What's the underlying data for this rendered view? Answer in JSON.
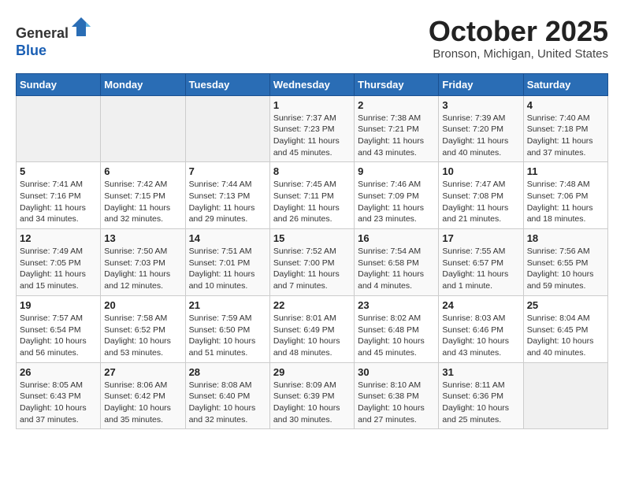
{
  "header": {
    "logo_line1": "General",
    "logo_line2": "Blue",
    "month_title": "October 2025",
    "location": "Bronson, Michigan, United States"
  },
  "weekdays": [
    "Sunday",
    "Monday",
    "Tuesday",
    "Wednesday",
    "Thursday",
    "Friday",
    "Saturday"
  ],
  "weeks": [
    [
      {
        "day": "",
        "info": ""
      },
      {
        "day": "",
        "info": ""
      },
      {
        "day": "",
        "info": ""
      },
      {
        "day": "1",
        "info": "Sunrise: 7:37 AM\nSunset: 7:23 PM\nDaylight: 11 hours\nand 45 minutes."
      },
      {
        "day": "2",
        "info": "Sunrise: 7:38 AM\nSunset: 7:21 PM\nDaylight: 11 hours\nand 43 minutes."
      },
      {
        "day": "3",
        "info": "Sunrise: 7:39 AM\nSunset: 7:20 PM\nDaylight: 11 hours\nand 40 minutes."
      },
      {
        "day": "4",
        "info": "Sunrise: 7:40 AM\nSunset: 7:18 PM\nDaylight: 11 hours\nand 37 minutes."
      }
    ],
    [
      {
        "day": "5",
        "info": "Sunrise: 7:41 AM\nSunset: 7:16 PM\nDaylight: 11 hours\nand 34 minutes."
      },
      {
        "day": "6",
        "info": "Sunrise: 7:42 AM\nSunset: 7:15 PM\nDaylight: 11 hours\nand 32 minutes."
      },
      {
        "day": "7",
        "info": "Sunrise: 7:44 AM\nSunset: 7:13 PM\nDaylight: 11 hours\nand 29 minutes."
      },
      {
        "day": "8",
        "info": "Sunrise: 7:45 AM\nSunset: 7:11 PM\nDaylight: 11 hours\nand 26 minutes."
      },
      {
        "day": "9",
        "info": "Sunrise: 7:46 AM\nSunset: 7:09 PM\nDaylight: 11 hours\nand 23 minutes."
      },
      {
        "day": "10",
        "info": "Sunrise: 7:47 AM\nSunset: 7:08 PM\nDaylight: 11 hours\nand 21 minutes."
      },
      {
        "day": "11",
        "info": "Sunrise: 7:48 AM\nSunset: 7:06 PM\nDaylight: 11 hours\nand 18 minutes."
      }
    ],
    [
      {
        "day": "12",
        "info": "Sunrise: 7:49 AM\nSunset: 7:05 PM\nDaylight: 11 hours\nand 15 minutes."
      },
      {
        "day": "13",
        "info": "Sunrise: 7:50 AM\nSunset: 7:03 PM\nDaylight: 11 hours\nand 12 minutes."
      },
      {
        "day": "14",
        "info": "Sunrise: 7:51 AM\nSunset: 7:01 PM\nDaylight: 11 hours\nand 10 minutes."
      },
      {
        "day": "15",
        "info": "Sunrise: 7:52 AM\nSunset: 7:00 PM\nDaylight: 11 hours\nand 7 minutes."
      },
      {
        "day": "16",
        "info": "Sunrise: 7:54 AM\nSunset: 6:58 PM\nDaylight: 11 hours\nand 4 minutes."
      },
      {
        "day": "17",
        "info": "Sunrise: 7:55 AM\nSunset: 6:57 PM\nDaylight: 11 hours\nand 1 minute."
      },
      {
        "day": "18",
        "info": "Sunrise: 7:56 AM\nSunset: 6:55 PM\nDaylight: 10 hours\nand 59 minutes."
      }
    ],
    [
      {
        "day": "19",
        "info": "Sunrise: 7:57 AM\nSunset: 6:54 PM\nDaylight: 10 hours\nand 56 minutes."
      },
      {
        "day": "20",
        "info": "Sunrise: 7:58 AM\nSunset: 6:52 PM\nDaylight: 10 hours\nand 53 minutes."
      },
      {
        "day": "21",
        "info": "Sunrise: 7:59 AM\nSunset: 6:50 PM\nDaylight: 10 hours\nand 51 minutes."
      },
      {
        "day": "22",
        "info": "Sunrise: 8:01 AM\nSunset: 6:49 PM\nDaylight: 10 hours\nand 48 minutes."
      },
      {
        "day": "23",
        "info": "Sunrise: 8:02 AM\nSunset: 6:48 PM\nDaylight: 10 hours\nand 45 minutes."
      },
      {
        "day": "24",
        "info": "Sunrise: 8:03 AM\nSunset: 6:46 PM\nDaylight: 10 hours\nand 43 minutes."
      },
      {
        "day": "25",
        "info": "Sunrise: 8:04 AM\nSunset: 6:45 PM\nDaylight: 10 hours\nand 40 minutes."
      }
    ],
    [
      {
        "day": "26",
        "info": "Sunrise: 8:05 AM\nSunset: 6:43 PM\nDaylight: 10 hours\nand 37 minutes."
      },
      {
        "day": "27",
        "info": "Sunrise: 8:06 AM\nSunset: 6:42 PM\nDaylight: 10 hours\nand 35 minutes."
      },
      {
        "day": "28",
        "info": "Sunrise: 8:08 AM\nSunset: 6:40 PM\nDaylight: 10 hours\nand 32 minutes."
      },
      {
        "day": "29",
        "info": "Sunrise: 8:09 AM\nSunset: 6:39 PM\nDaylight: 10 hours\nand 30 minutes."
      },
      {
        "day": "30",
        "info": "Sunrise: 8:10 AM\nSunset: 6:38 PM\nDaylight: 10 hours\nand 27 minutes."
      },
      {
        "day": "31",
        "info": "Sunrise: 8:11 AM\nSunset: 6:36 PM\nDaylight: 10 hours\nand 25 minutes."
      },
      {
        "day": "",
        "info": ""
      }
    ]
  ]
}
